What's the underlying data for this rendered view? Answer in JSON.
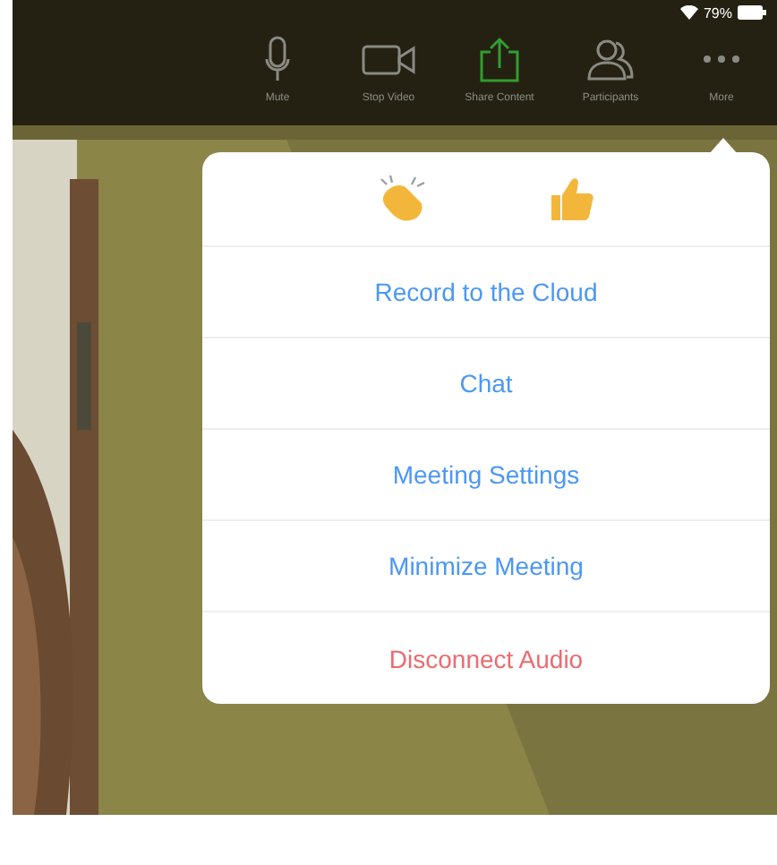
{
  "status_bar": {
    "battery": "79%"
  },
  "toolbar": [
    {
      "kind": "mic",
      "label": "Mute",
      "highlighted": false
    },
    {
      "kind": "video",
      "label": "Stop Video",
      "highlighted": false
    },
    {
      "kind": "share",
      "label": "Share Content",
      "highlighted": true
    },
    {
      "kind": "people",
      "label": "Participants",
      "highlighted": false
    },
    {
      "kind": "more",
      "label": "More",
      "highlighted": false
    }
  ],
  "menu": {
    "reactions": [
      {
        "kind": "clap"
      },
      {
        "kind": "thumbs"
      }
    ],
    "items": [
      {
        "label": "Record to the Cloud",
        "kind": "normal"
      },
      {
        "label": "Chat",
        "kind": "normal"
      },
      {
        "label": "Meeting Settings",
        "kind": "normal"
      },
      {
        "label": "Minimize Meeting",
        "kind": "normal"
      },
      {
        "label": "Disconnect Audio",
        "kind": "danger"
      }
    ]
  }
}
